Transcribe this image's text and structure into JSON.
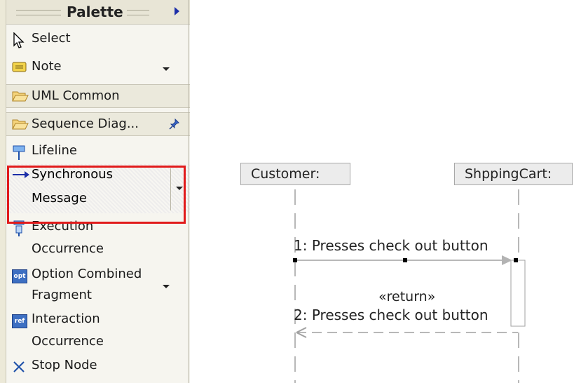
{
  "palette": {
    "title": "Palette",
    "tools": {
      "select": "Select",
      "note": "Note"
    },
    "drawers": {
      "uml_common": "UML Common",
      "sequence_diagram": "Sequence Diag..."
    },
    "sequence_items": {
      "lifeline": "Lifeline",
      "sync_line1": "Synchronous",
      "sync_line2": "Message",
      "exec_line1": "Execution",
      "exec_line2": "Occurrence",
      "opt_line1": "Option Combined",
      "opt_line2": "Fragment",
      "interaction_line1": "Interaction",
      "interaction_line2": "Occurrence",
      "stop_node": "Stop Node"
    },
    "icon_text": {
      "opt": "opt",
      "ref": "ref"
    }
  },
  "diagram": {
    "lifelines": [
      "Customer:",
      "ShppingCart:"
    ],
    "message1": "1: Presses check out button",
    "return_stereotype": "«return»",
    "message2": "2: Presses check out button"
  },
  "colors": {
    "highlight_frame": "#e11b1b",
    "arrow_blue": "#1c2ea8"
  }
}
